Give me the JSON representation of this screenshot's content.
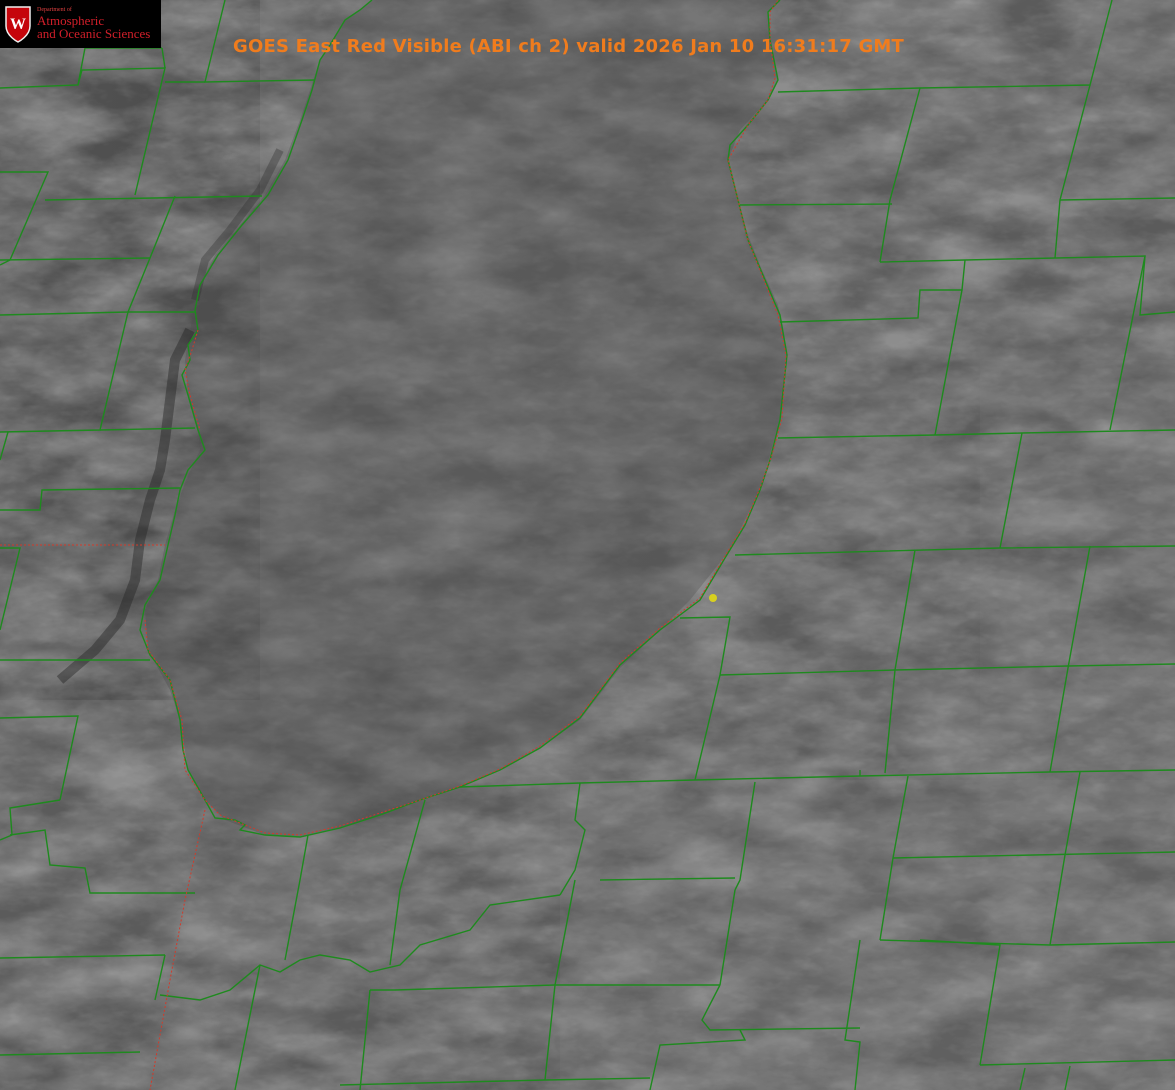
{
  "title": "GOES East Red Visible (ABI ch 2) valid 2026 Jan 10 16:31:17 GMT",
  "logo": {
    "crest_letter": "W",
    "department": "Department of",
    "line1": "Atmospheric",
    "line2": "and Oceanic Sciences"
  },
  "colors": {
    "title": "#f07c1d",
    "boundary": "#1e8a1e",
    "shoreline": "#d23a2a",
    "marker": "#d8d020"
  },
  "icons": {
    "crest": "uw-crest-icon",
    "marker": "location-dot-icon"
  }
}
